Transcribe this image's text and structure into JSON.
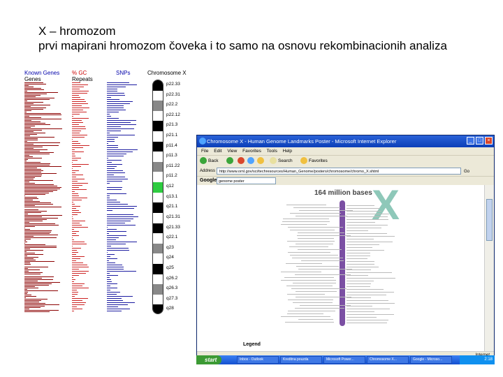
{
  "slide": {
    "title_line1": "X – hromozom",
    "title_line2": "prvi mapirani hromozom čoveka i to samo na osnovu rekombinacionih analiza"
  },
  "gene_map": {
    "col_known_genes": "Known Genes",
    "col_genes": "Genes",
    "col_gc": "% GC",
    "col_repeats": "Repeats",
    "col_snps": "SNPs",
    "col_chromosome": "Chromosome X",
    "band_labels": [
      "p22.33",
      "p22.31",
      "p22.2",
      "p22.12",
      "p21.3",
      "p21.1",
      "p11.4",
      "p11.3",
      "p11.22",
      "p11.2",
      "q12",
      "q13.1",
      "q21.1",
      "q21.31",
      "q21.33",
      "q22.1",
      "q23",
      "q24",
      "q25",
      "q26.2",
      "q26.3",
      "q27.3",
      "q28"
    ]
  },
  "browser": {
    "window_title": "Chromosome X - Human Genome Landmarks Poster - Microsoft Internet Explorer",
    "window_buttons": [
      "_",
      "□",
      "×"
    ],
    "menu": [
      "File",
      "Edit",
      "View",
      "Favorites",
      "Tools",
      "Help"
    ],
    "toolbar": {
      "back": "Back",
      "search": "Search",
      "favorites": "Favorites"
    },
    "address_label": "Address",
    "address_value": "http://www.ornl.gov/sci/techresources/Human_Genome/posters/chromosome/chromo_X.shtml",
    "go_label": "Go",
    "google_label": "Google",
    "google_search_value": "genome poster",
    "page_heading": "164 million bases",
    "big_letter": "X",
    "legend_label": "Legend",
    "zoom": "Internet",
    "colors": {
      "titlebar": "#0b3fb8",
      "chromosome": "#7b4fa3",
      "big_letter": "#8ec8b9"
    }
  },
  "taskbar": {
    "start_label": "start",
    "tasks": [
      "Inbox - Outlook",
      "Kreditna pouzda",
      "Microsoft Power...",
      "Chromosome X...",
      "Google - Microso..."
    ],
    "tray_time": "2:18"
  }
}
